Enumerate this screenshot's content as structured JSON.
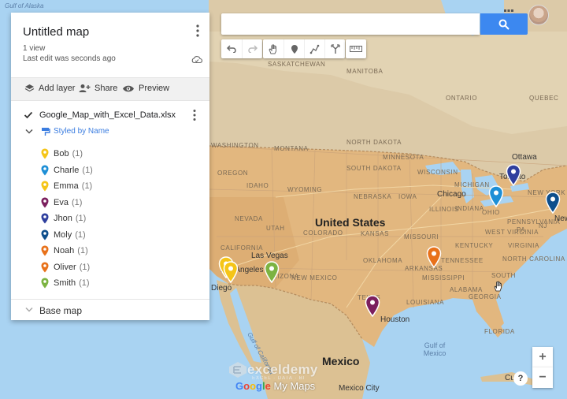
{
  "app": {
    "map_title": "Untitled map",
    "views": "1 view",
    "last_edit": "Last edit was seconds ago"
  },
  "actions": {
    "add_layer": "Add layer",
    "share": "Share",
    "preview": "Preview"
  },
  "layer": {
    "name": "Google_Map_with_Excel_Data.xlsx",
    "style_label": "Styled by Name",
    "checked": true,
    "items": [
      {
        "name": "Bob",
        "count": "(1)",
        "color": "#f5c518"
      },
      {
        "name": "Charle",
        "count": "(1)",
        "color": "#1e8fd6"
      },
      {
        "name": "Emma",
        "count": "(1)",
        "color": "#f5c518"
      },
      {
        "name": "Eva",
        "count": "(1)",
        "color": "#7b1f5e"
      },
      {
        "name": "Jhon",
        "count": "(1)",
        "color": "#2f3f9e"
      },
      {
        "name": "Moly",
        "count": "(1)",
        "color": "#0d4e8c"
      },
      {
        "name": "Noah",
        "count": "(1)",
        "color": "#e8711a"
      },
      {
        "name": "Oliver",
        "count": "(1)",
        "color": "#e8711a"
      },
      {
        "name": "Smith",
        "count": "(1)",
        "color": "#7cb342"
      }
    ]
  },
  "base_map": {
    "label": "Base map"
  },
  "search": {
    "value": ""
  },
  "zoom": {
    "in": "+",
    "out": "−"
  },
  "help": "?",
  "map_labels": {
    "gulf_alaska": "Gulf of Alaska",
    "saskatchewan": "SASKATCHEWAN",
    "manitoba": "MANITOBA",
    "ontario": "ONTARIO",
    "quebec": "QUEBEC",
    "washington": "WASHINGTON",
    "montana": "MONTANA",
    "north_dakota": "NORTH DAKOTA",
    "south_dakota": "SOUTH DAKOTA",
    "oregon": "OREGON",
    "idaho": "IDAHO",
    "wyoming": "WYOMING",
    "nebraska": "NEBRASKA",
    "minnesota": "MINNESOTA",
    "wisconsin": "WISCONSIN",
    "michigan": "MICHIGAN",
    "iowa": "IOWA",
    "illinois": "ILLINOIS",
    "indiana": "INDIANA",
    "ohio": "OHIO",
    "nevada": "NEVADA",
    "utah": "UTAH",
    "colorado": "COLORADO",
    "kansas": "KANSAS",
    "missouri": "MISSOURI",
    "kentucky": "KENTUCKY",
    "west_virginia": "WEST VIRGINIA",
    "virginia": "VIRGINIA",
    "california": "CALIFORNIA",
    "arizona": "ARIZONA",
    "new_mexico": "NEW MEXICO",
    "oklahoma": "OKLAHOMA",
    "arkansas": "ARKANSAS",
    "tennessee": "TENNESSEE",
    "north_carolina": "NORTH CAROLINA",
    "south_carolina": "SOUTH CAROLINA",
    "mississippi": "MISSISSIPPI",
    "alabama": "ALABAMA",
    "georgia": "GEORGIA",
    "texas": "TEXAS",
    "louisiana": "LOUISIANA",
    "florida": "FLORIDA",
    "new_york": "NEW YORK",
    "pennsylvania": "PENNSYLVANIA",
    "pa_abbrev": "PA",
    "nj_abbrev": "NJ",
    "united_states": "United States",
    "mexico": "Mexico",
    "ottawa": "Ottawa",
    "toronto": "Toronto",
    "chicago": "Chicago",
    "las_vegas": "Las Vegas",
    "los_angeles": "Los Angeles",
    "san_diego": "Diego",
    "houston": "Houston",
    "new_york_city": "New",
    "mexico_city": "Mexico City",
    "gulf_of_mexico": "Gulf of Mexico",
    "gulf_of_california": "Gulf of California",
    "cuba": "Cu",
    "south_short": "SOUTH"
  },
  "watermark": {
    "brand": "exceldemy",
    "brand_sub": "EXCEL · DATA · BI",
    "footer_google": "Google",
    "footer_mymaps": " My Maps"
  }
}
